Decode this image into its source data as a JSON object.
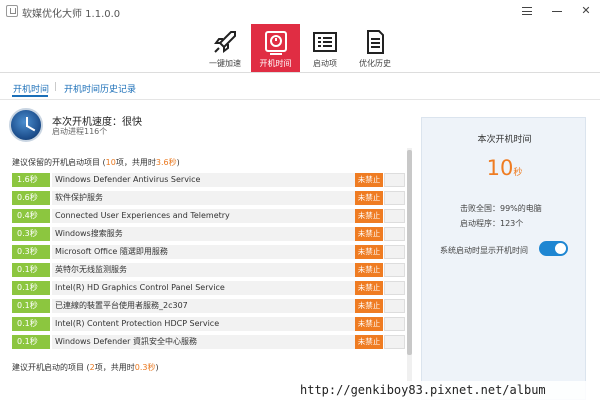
{
  "window": {
    "title": "软媒优化大师 1.1.0.0",
    "controls": [
      "menu-icon",
      "minimize-icon",
      "close-icon"
    ],
    "close_glyph": "✕"
  },
  "nav": {
    "tabs": [
      {
        "label": "一键加速",
        "icon": "rocket-icon",
        "active": false
      },
      {
        "label": "开机时间",
        "icon": "stopwatch-icon",
        "active": true
      },
      {
        "label": "启动项",
        "icon": "startup-list-icon",
        "active": false
      },
      {
        "label": "优化历史",
        "icon": "history-document-icon",
        "active": false
      }
    ],
    "active_color": "#e02d43"
  },
  "subtabs": {
    "active": "开机时间",
    "separator": "|",
    "other": "开机时间历史记录"
  },
  "summary": {
    "speed": "本次开机速度：很快",
    "processes": "启动进程116个"
  },
  "section1": {
    "prefix": "建议保留的开机启动项目 (",
    "count": "10",
    "middle": "项，共用时",
    "time": "3.6秒",
    "suffix": ")"
  },
  "rows": [
    {
      "time": "1.6秒",
      "name": "Windows Defender Antivirus Service",
      "action": "未禁止"
    },
    {
      "time": "0.6秒",
      "name": "软件保护服务",
      "action": "未禁止"
    },
    {
      "time": "0.4秒",
      "name": "Connected User Experiences and Telemetry",
      "action": "未禁止"
    },
    {
      "time": "0.3秒",
      "name": "Windows搜索服务",
      "action": "未禁止"
    },
    {
      "time": "0.3秒",
      "name": "Microsoft Office 隨選即用服務",
      "action": "未禁止"
    },
    {
      "time": "0.1秒",
      "name": "英特尔无线监测服务",
      "action": "未禁止"
    },
    {
      "time": "0.1秒",
      "name": "Intel(R) HD Graphics Control Panel Service",
      "action": "未禁止"
    },
    {
      "time": "0.1秒",
      "name": "已連線的裝置平台使用者服務_2c307",
      "action": "未禁止"
    },
    {
      "time": "0.1秒",
      "name": "Intel(R) Content Protection HDCP Service",
      "action": "未禁止"
    },
    {
      "time": "0.1秒",
      "name": "Windows Defender 資訊安全中心服務",
      "action": "未禁止"
    }
  ],
  "section2": {
    "prefix": "建议开机启动的项目 (",
    "count": "2",
    "middle": "项，共用时",
    "time": "0.3秒",
    "suffix": ")"
  },
  "panel": {
    "title": "本次开机时间",
    "value": "10",
    "unit": "秒",
    "beat": "击败全国：99%的电脑",
    "programs": "启动程序：123个",
    "toggle_label": "系统启动时显示开机时间",
    "toggle_on": true
  },
  "colors": {
    "time_badge": "#8cc63f",
    "action_button": "#ef7c22",
    "accent_orange": "#ef7c22",
    "link_blue": "#1b6fb8",
    "switch_blue": "#1e86d2"
  },
  "watermark": "http://genkiboy83.pixnet.net/album"
}
